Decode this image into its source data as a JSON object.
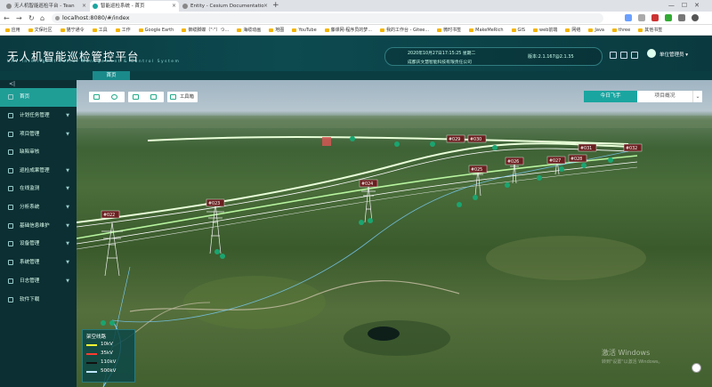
{
  "browser": {
    "tabs": [
      {
        "title": "无人机智能巡检平台 - Tean",
        "active": false
      },
      {
        "title": "智能巡检系统 - 首页",
        "active": true
      },
      {
        "title": "Entity - Cesium Documentatio",
        "active": false
      }
    ],
    "url": "localhost:8080/#/index",
    "bookmarks": [
      "应用",
      "文保社区",
      "猫宁通令",
      "工具",
      "工作",
      "Google Earth",
      "御缆脚蝶（\"·\"）つ...",
      "海缆动画",
      "地图",
      "YouTube",
      "藤课网·程序员的梦...",
      "我的工作台 - Gitee...",
      "微时书签",
      "MakeMeRich",
      "GIS",
      "web前端",
      "网络",
      "Java",
      "three",
      "其他书签"
    ]
  },
  "header": {
    "title": "无人机智能巡检管控平台",
    "subtitle": "UAV Intelligent Patrol Management & Control System",
    "datetime": "2020年10月27日17:15:25 星期二",
    "company": "成都庆文慧智能科技有限责任公司",
    "version": "版本:2.1.167@2.1.35",
    "username": "单位管理员",
    "page_tab": "首页"
  },
  "sidebar": {
    "collapse_label": "<|",
    "items": [
      {
        "label": "首页",
        "active": true,
        "has_arrow": false
      },
      {
        "label": "计划任务管理",
        "active": false,
        "has_arrow": true
      },
      {
        "label": "项目管理",
        "active": false,
        "has_arrow": true
      },
      {
        "label": "缺陷审核",
        "active": false,
        "has_arrow": false
      },
      {
        "label": "巡检成果管理",
        "active": false,
        "has_arrow": true
      },
      {
        "label": "在线监测",
        "active": false,
        "has_arrow": true
      },
      {
        "label": "分析系统",
        "active": false,
        "has_arrow": true
      },
      {
        "label": "基础信息维护",
        "active": false,
        "has_arrow": true
      },
      {
        "label": "设备管理",
        "active": false,
        "has_arrow": true
      },
      {
        "label": "系统管理",
        "active": false,
        "has_arrow": true
      },
      {
        "label": "日志管理",
        "active": false,
        "has_arrow": true
      },
      {
        "label": "软件下载",
        "active": false,
        "has_arrow": false
      }
    ]
  },
  "map": {
    "toolbox_label": "工具箱",
    "flight_today": "今日飞手",
    "project_overview": "项目概况",
    "tower_labels": [
      "#022",
      "#023",
      "#024",
      "#025",
      "#026",
      "#027",
      "#028",
      "#029",
      "#030",
      "#031",
      "#032"
    ],
    "legend": {
      "title": "架空线路",
      "items": [
        {
          "label": "10kV",
          "color": "#ffff33"
        },
        {
          "label": "35kV",
          "color": "#ff3b30"
        },
        {
          "label": "110kV",
          "color": "#111111"
        },
        {
          "label": "500kV",
          "color": "#bfe6ff"
        }
      ]
    },
    "watermark": [
      "激活 Windows",
      "转到\"设置\"以激活 Windows。"
    ]
  }
}
